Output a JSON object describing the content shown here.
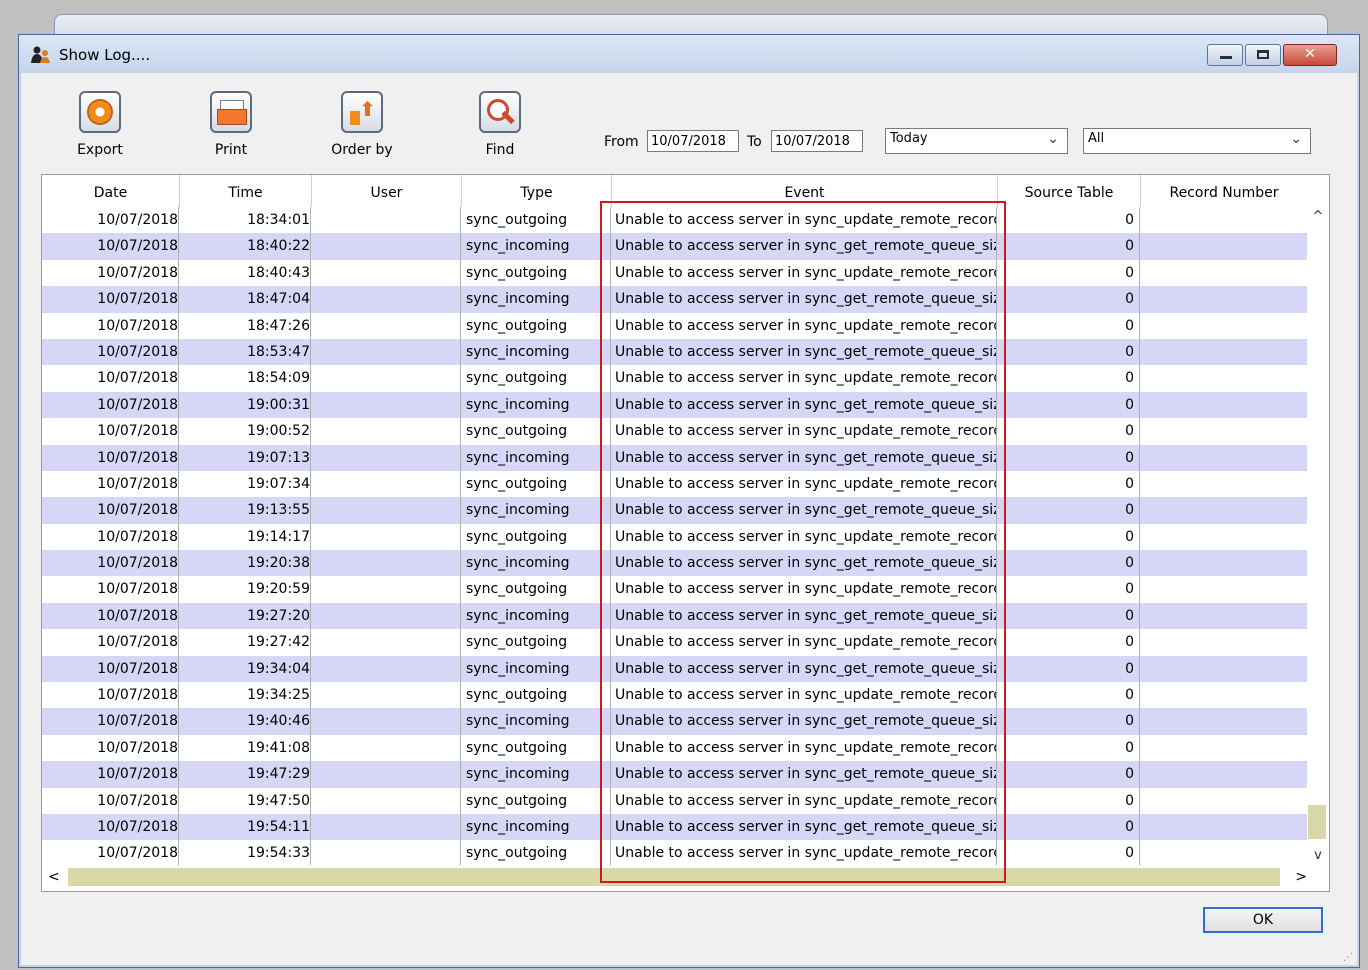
{
  "window": {
    "title": "Show Log...."
  },
  "toolbar": {
    "export_label": "Export",
    "print_label": "Print",
    "order_label": "Order by",
    "find_label": "Find"
  },
  "filters": {
    "from_label": "From",
    "from_value": "10/07/2018",
    "to_label": "To",
    "to_value": "10/07/2018",
    "range_value": "Today",
    "filter_value": "All"
  },
  "table": {
    "columns": [
      "Date",
      "Time",
      "User",
      "Type",
      "Event",
      "Source Table",
      "Record Number"
    ],
    "rows": [
      {
        "date": "10/07/2018",
        "time": "18:34:01",
        "user": "",
        "type": "sync_outgoing",
        "event": "Unable to access server in sync_update_remote_record...",
        "source": "0",
        "record": ""
      },
      {
        "date": "10/07/2018",
        "time": "18:40:22",
        "user": "",
        "type": "sync_incoming",
        "event": "Unable to access server in sync_get_remote_queue_siz...",
        "source": "0",
        "record": ""
      },
      {
        "date": "10/07/2018",
        "time": "18:40:43",
        "user": "",
        "type": "sync_outgoing",
        "event": "Unable to access server in sync_update_remote_record...",
        "source": "0",
        "record": ""
      },
      {
        "date": "10/07/2018",
        "time": "18:47:04",
        "user": "",
        "type": "sync_incoming",
        "event": "Unable to access server in sync_get_remote_queue_siz...",
        "source": "0",
        "record": ""
      },
      {
        "date": "10/07/2018",
        "time": "18:47:26",
        "user": "",
        "type": "sync_outgoing",
        "event": "Unable to access server in sync_update_remote_record...",
        "source": "0",
        "record": ""
      },
      {
        "date": "10/07/2018",
        "time": "18:53:47",
        "user": "",
        "type": "sync_incoming",
        "event": "Unable to access server in sync_get_remote_queue_siz...",
        "source": "0",
        "record": ""
      },
      {
        "date": "10/07/2018",
        "time": "18:54:09",
        "user": "",
        "type": "sync_outgoing",
        "event": "Unable to access server in sync_update_remote_record...",
        "source": "0",
        "record": ""
      },
      {
        "date": "10/07/2018",
        "time": "19:00:31",
        "user": "",
        "type": "sync_incoming",
        "event": "Unable to access server in sync_get_remote_queue_siz...",
        "source": "0",
        "record": ""
      },
      {
        "date": "10/07/2018",
        "time": "19:00:52",
        "user": "",
        "type": "sync_outgoing",
        "event": "Unable to access server in sync_update_remote_record...",
        "source": "0",
        "record": ""
      },
      {
        "date": "10/07/2018",
        "time": "19:07:13",
        "user": "",
        "type": "sync_incoming",
        "event": "Unable to access server in sync_get_remote_queue_siz...",
        "source": "0",
        "record": ""
      },
      {
        "date": "10/07/2018",
        "time": "19:07:34",
        "user": "",
        "type": "sync_outgoing",
        "event": "Unable to access server in sync_update_remote_record...",
        "source": "0",
        "record": ""
      },
      {
        "date": "10/07/2018",
        "time": "19:13:55",
        "user": "",
        "type": "sync_incoming",
        "event": "Unable to access server in sync_get_remote_queue_siz...",
        "source": "0",
        "record": ""
      },
      {
        "date": "10/07/2018",
        "time": "19:14:17",
        "user": "",
        "type": "sync_outgoing",
        "event": "Unable to access server in sync_update_remote_record...",
        "source": "0",
        "record": ""
      },
      {
        "date": "10/07/2018",
        "time": "19:20:38",
        "user": "",
        "type": "sync_incoming",
        "event": "Unable to access server in sync_get_remote_queue_siz...",
        "source": "0",
        "record": ""
      },
      {
        "date": "10/07/2018",
        "time": "19:20:59",
        "user": "",
        "type": "sync_outgoing",
        "event": "Unable to access server in sync_update_remote_record...",
        "source": "0",
        "record": ""
      },
      {
        "date": "10/07/2018",
        "time": "19:27:20",
        "user": "",
        "type": "sync_incoming",
        "event": "Unable to access server in sync_get_remote_queue_siz...",
        "source": "0",
        "record": ""
      },
      {
        "date": "10/07/2018",
        "time": "19:27:42",
        "user": "",
        "type": "sync_outgoing",
        "event": "Unable to access server in sync_update_remote_record...",
        "source": "0",
        "record": ""
      },
      {
        "date": "10/07/2018",
        "time": "19:34:04",
        "user": "",
        "type": "sync_incoming",
        "event": "Unable to access server in sync_get_remote_queue_siz...",
        "source": "0",
        "record": ""
      },
      {
        "date": "10/07/2018",
        "time": "19:34:25",
        "user": "",
        "type": "sync_outgoing",
        "event": "Unable to access server in sync_update_remote_record...",
        "source": "0",
        "record": ""
      },
      {
        "date": "10/07/2018",
        "time": "19:40:46",
        "user": "",
        "type": "sync_incoming",
        "event": "Unable to access server in sync_get_remote_queue_siz...",
        "source": "0",
        "record": ""
      },
      {
        "date": "10/07/2018",
        "time": "19:41:08",
        "user": "",
        "type": "sync_outgoing",
        "event": "Unable to access server in sync_update_remote_record...",
        "source": "0",
        "record": ""
      },
      {
        "date": "10/07/2018",
        "time": "19:47:29",
        "user": "",
        "type": "sync_incoming",
        "event": "Unable to access server in sync_get_remote_queue_siz...",
        "source": "0",
        "record": ""
      },
      {
        "date": "10/07/2018",
        "time": "19:47:50",
        "user": "",
        "type": "sync_outgoing",
        "event": "Unable to access server in sync_update_remote_record...",
        "source": "0",
        "record": ""
      },
      {
        "date": "10/07/2018",
        "time": "19:54:11",
        "user": "",
        "type": "sync_incoming",
        "event": "Unable to access server in sync_get_remote_queue_siz...",
        "source": "0",
        "record": ""
      },
      {
        "date": "10/07/2018",
        "time": "19:54:33",
        "user": "",
        "type": "sync_outgoing",
        "event": "Unable to access server in sync_update_remote_record...",
        "source": "0",
        "record": ""
      }
    ]
  },
  "scroll": {
    "up_arrow": "^",
    "down_arrow": "v",
    "left_arrow": "<",
    "right_arrow": ">"
  },
  "footer": {
    "ok_label": "OK"
  },
  "colors": {
    "alt_row": "#d6d6f6",
    "highlight_border": "#d0191e",
    "scroll_thumb": "#d8d8a8"
  }
}
